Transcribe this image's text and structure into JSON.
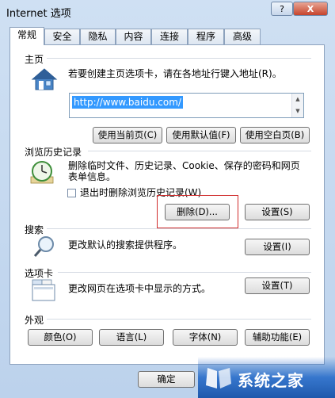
{
  "window": {
    "title": "Internet 选项",
    "help_label": "?",
    "close_label": "X"
  },
  "tabs": [
    "常规",
    "安全",
    "隐私",
    "内容",
    "连接",
    "程序",
    "高级"
  ],
  "home": {
    "section_title": "主页",
    "description": "若要创建主页选项卡，请在各地址行键入地址(R)。",
    "url": "http://www.baidu.com/",
    "buttons": [
      "使用当前页(C)",
      "使用默认值(F)",
      "使用空白页(B)"
    ]
  },
  "history": {
    "section_title": "浏览历史记录",
    "description_line1": "删除临时文件、历史记录、Cookie、保存的密码和网页",
    "description_line2": "表单信息。",
    "checkbox_label": "退出时删除浏览历史记录(W)",
    "checkbox_checked": false,
    "delete_button": "删除(D)...",
    "settings_button": "设置(S)"
  },
  "search": {
    "section_title": "搜索",
    "description": "更改默认的搜索提供程序。",
    "settings_button": "设置(I)"
  },
  "tabs_section": {
    "section_title": "选项卡",
    "description": "更改网页在选项卡中显示的方式。",
    "settings_button": "设置(T)"
  },
  "appearance": {
    "section_title": "外观",
    "buttons": [
      "颜色(O)",
      "语言(L)",
      "字体(N)",
      "辅助功能(E)"
    ]
  },
  "footer": {
    "ok_button": "确定"
  },
  "watermark": {
    "text": "系统之家"
  },
  "colors": {
    "highlight_border": "#d02c2c",
    "selection": "#3399ff"
  }
}
